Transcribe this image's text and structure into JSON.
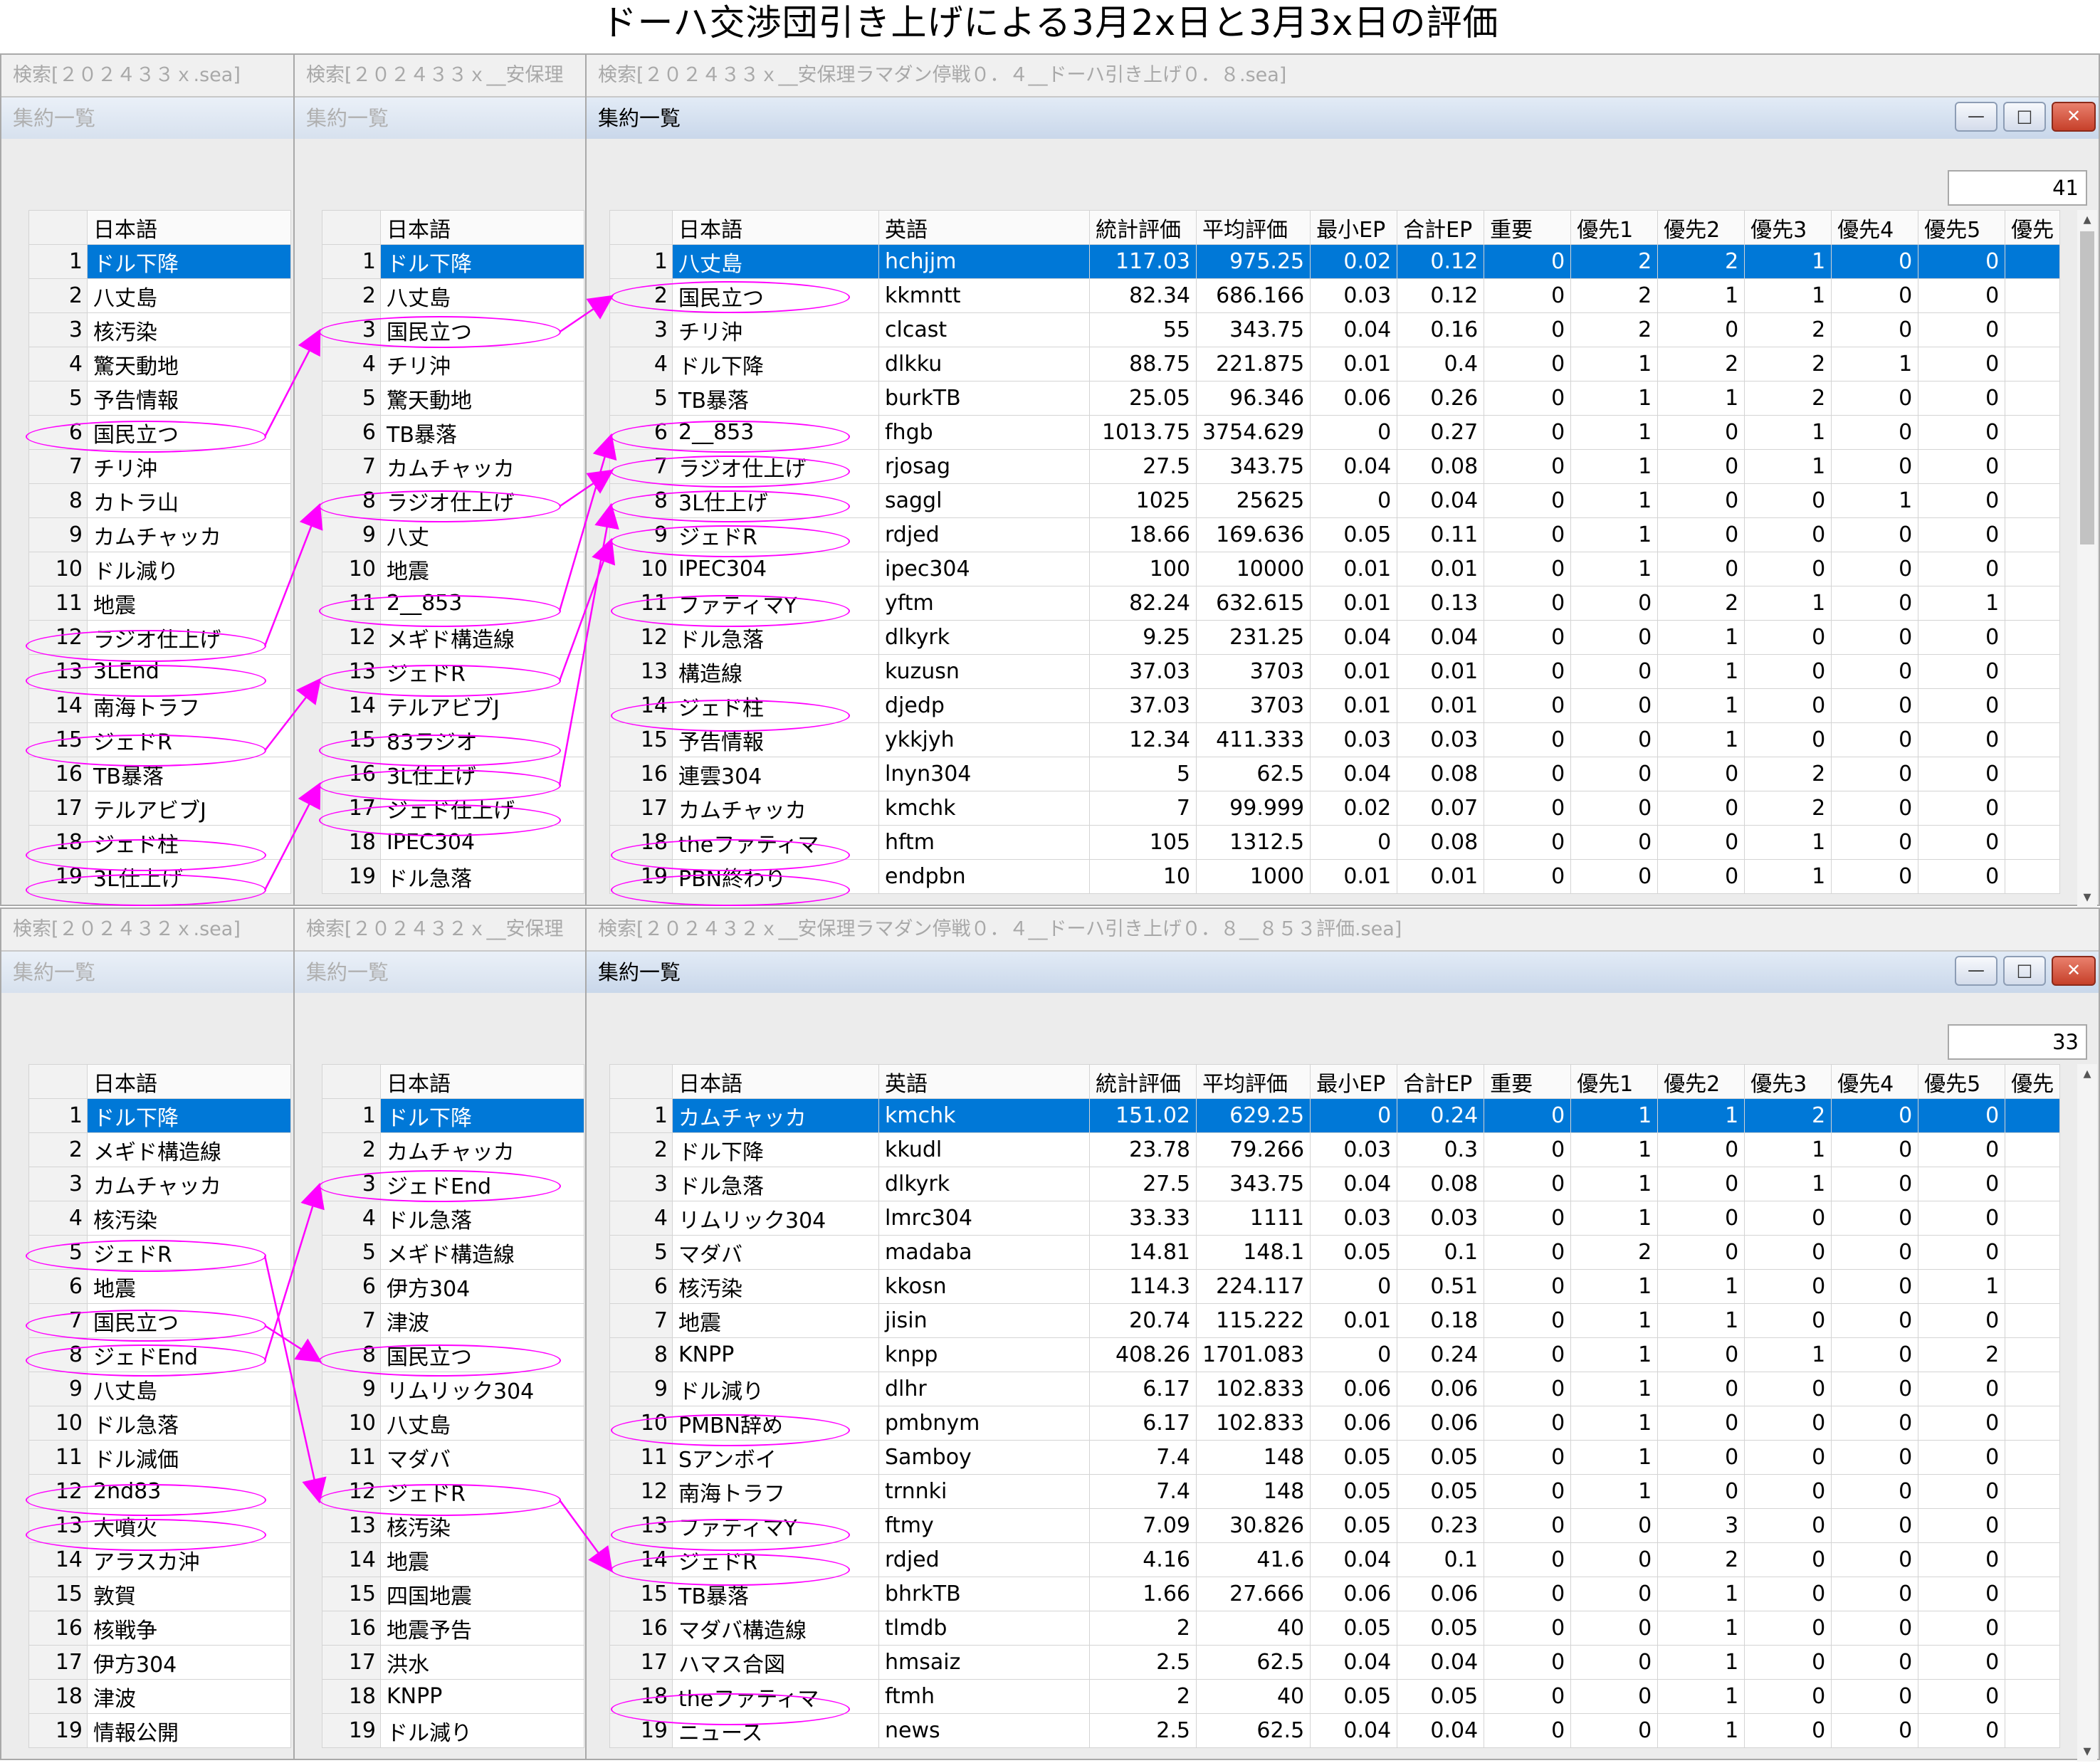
{
  "title": "ドーハ交渉団引き上げによる3月2x日と3月3x日の評価",
  "accent_color": "#0078d7",
  "annotation_color": "#ff00ff",
  "top": {
    "win1_title": "検索[２０２４３３ｘ.sea]",
    "win2_title": "検索[２０２４３３ｘ__安保理",
    "win3_title": "検索[２０２４３３ｘ__安保理ラマダン停戦０．４__ドーハ引き上げ０．８.sea]",
    "subtitle": "集約一覧",
    "count": "41",
    "col_jp": "日本語",
    "list1": [
      "ドル下降",
      "八丈島",
      "核汚染",
      "驚天動地",
      "予告情報",
      "国民立つ",
      "チリ沖",
      "カトラ山",
      "カムチャッカ",
      "ドル減り",
      "地震",
      "ラジオ仕上げ",
      "3LEnd",
      "南海トラフ",
      "ジェドR",
      "TB暴落",
      "テルアビブJ",
      "ジェド柱",
      "3L仕上げ"
    ],
    "list2": [
      "ドル下降",
      "八丈島",
      "国民立つ",
      "チリ沖",
      "驚天動地",
      "TB暴落",
      "カムチャッカ",
      "ラジオ仕上げ",
      "八丈",
      "地震",
      "2__853",
      "メギド構造線",
      "ジェドR",
      "テルアビブJ",
      "83ラジオ",
      "3L仕上げ",
      "ジェド仕上げ",
      "IPEC304",
      "ドル急落"
    ],
    "headers": [
      "日本語",
      "英語",
      "統計評価",
      "平均評価",
      "最小EP",
      "合計EP",
      "重要",
      "優先1",
      "優先2",
      "優先3",
      "優先4",
      "優先5",
      "優先"
    ],
    "rows": [
      [
        "八丈島",
        "hchjjm",
        "117.03",
        "975.25",
        "0.02",
        "0.12",
        "0",
        "2",
        "2",
        "1",
        "0",
        "0"
      ],
      [
        "国民立つ",
        "kkmntt",
        "82.34",
        "686.166",
        "0.03",
        "0.12",
        "0",
        "2",
        "1",
        "1",
        "0",
        "0"
      ],
      [
        "チリ沖",
        "clcast",
        "55",
        "343.75",
        "0.04",
        "0.16",
        "0",
        "2",
        "0",
        "2",
        "0",
        "0"
      ],
      [
        "ドル下降",
        "dlkku",
        "88.75",
        "221.875",
        "0.01",
        "0.4",
        "0",
        "1",
        "2",
        "2",
        "1",
        "0"
      ],
      [
        "TB暴落",
        "burkTB",
        "25.05",
        "96.346",
        "0.06",
        "0.26",
        "0",
        "1",
        "1",
        "2",
        "0",
        "0"
      ],
      [
        "2__853",
        "fhgb",
        "1013.75",
        "3754.629",
        "0",
        "0.27",
        "0",
        "1",
        "0",
        "1",
        "0",
        "0"
      ],
      [
        "ラジオ仕上げ",
        "rjosag",
        "27.5",
        "343.75",
        "0.04",
        "0.08",
        "0",
        "1",
        "0",
        "1",
        "0",
        "0"
      ],
      [
        "3L仕上げ",
        "saggl",
        "1025",
        "25625",
        "0",
        "0.04",
        "0",
        "1",
        "0",
        "0",
        "1",
        "0"
      ],
      [
        "ジェドR",
        "rdjed",
        "18.66",
        "169.636",
        "0.05",
        "0.11",
        "0",
        "1",
        "0",
        "0",
        "0",
        "0"
      ],
      [
        "IPEC304",
        "ipec304",
        "100",
        "10000",
        "0.01",
        "0.01",
        "0",
        "1",
        "0",
        "0",
        "0",
        "0"
      ],
      [
        "ファティマY",
        "yftm",
        "82.24",
        "632.615",
        "0.01",
        "0.13",
        "0",
        "0",
        "2",
        "1",
        "0",
        "1"
      ],
      [
        "ドル急落",
        "dlkyrk",
        "9.25",
        "231.25",
        "0.04",
        "0.04",
        "0",
        "0",
        "1",
        "0",
        "0",
        "0"
      ],
      [
        "構造線",
        "kuzusn",
        "37.03",
        "3703",
        "0.01",
        "0.01",
        "0",
        "0",
        "1",
        "0",
        "0",
        "0"
      ],
      [
        "ジェド柱",
        "djedp",
        "37.03",
        "3703",
        "0.01",
        "0.01",
        "0",
        "0",
        "1",
        "0",
        "0",
        "0"
      ],
      [
        "予告情報",
        "ykkjyh",
        "12.34",
        "411.333",
        "0.03",
        "0.03",
        "0",
        "0",
        "1",
        "0",
        "0",
        "0"
      ],
      [
        "連雲304",
        "lnyn304",
        "5",
        "62.5",
        "0.04",
        "0.08",
        "0",
        "0",
        "0",
        "2",
        "0",
        "0"
      ],
      [
        "カムチャッカ",
        "kmchk",
        "7",
        "99.999",
        "0.02",
        "0.07",
        "0",
        "0",
        "0",
        "2",
        "0",
        "0"
      ],
      [
        "theファティマ",
        "hftm",
        "105",
        "1312.5",
        "0",
        "0.08",
        "0",
        "0",
        "0",
        "1",
        "0",
        "0"
      ],
      [
        "PBN終わり",
        "endpbn",
        "10",
        "1000",
        "0.01",
        "0.01",
        "0",
        "0",
        "0",
        "1",
        "0",
        "0"
      ]
    ]
  },
  "bottom": {
    "win1_title": "検索[２０２４３２ｘ.sea]",
    "win2_title": "検索[２０２４３２ｘ__安保理",
    "win3_title": "検索[２０２４３２ｘ__安保理ラマダン停戦０．４__ドーハ引き上げ０．８__８５３評価.sea]",
    "subtitle": "集約一覧",
    "count": "33",
    "col_jp": "日本語",
    "list1": [
      "ドル下降",
      "メギド構造線",
      "カムチャッカ",
      "核汚染",
      "ジェドR",
      "地震",
      "国民立つ",
      "ジェドEnd",
      "八丈島",
      "ドル急落",
      "ドル減価",
      "2nd83",
      "大噴火",
      "アラスカ沖",
      "敦賀",
      "核戦争",
      "伊方304",
      "津波",
      "情報公開"
    ],
    "list2": [
      "ドル下降",
      "カムチャッカ",
      "ジェドEnd",
      "ドル急落",
      "メギド構造線",
      "伊方304",
      "津波",
      "国民立つ",
      "リムリック304",
      "八丈島",
      "マダバ",
      "ジェドR",
      "核汚染",
      "地震",
      "四国地震",
      "地震予告",
      "洪水",
      "KNPP",
      "ドル減り"
    ],
    "headers": [
      "日本語",
      "英語",
      "統計評価",
      "平均評価",
      "最小EP",
      "合計EP",
      "重要",
      "優先1",
      "優先2",
      "優先3",
      "優先4",
      "優先5",
      "優先"
    ],
    "rows": [
      [
        "カムチャッカ",
        "kmchk",
        "151.02",
        "629.25",
        "0",
        "0.24",
        "0",
        "1",
        "1",
        "2",
        "0",
        "0"
      ],
      [
        "ドル下降",
        "kkudl",
        "23.78",
        "79.266",
        "0.03",
        "0.3",
        "0",
        "1",
        "0",
        "1",
        "0",
        "0"
      ],
      [
        "ドル急落",
        "dlkyrk",
        "27.5",
        "343.75",
        "0.04",
        "0.08",
        "0",
        "1",
        "0",
        "1",
        "0",
        "0"
      ],
      [
        "リムリック304",
        "lmrc304",
        "33.33",
        "1111",
        "0.03",
        "0.03",
        "0",
        "1",
        "0",
        "0",
        "0",
        "0"
      ],
      [
        "マダバ",
        "madaba",
        "14.81",
        "148.1",
        "0.05",
        "0.1",
        "0",
        "2",
        "0",
        "0",
        "0",
        "0"
      ],
      [
        "核汚染",
        "kkosn",
        "114.3",
        "224.117",
        "0",
        "0.51",
        "0",
        "1",
        "1",
        "0",
        "0",
        "1"
      ],
      [
        "地震",
        "jisin",
        "20.74",
        "115.222",
        "0.01",
        "0.18",
        "0",
        "1",
        "1",
        "0",
        "0",
        "0"
      ],
      [
        "KNPP",
        "knpp",
        "408.26",
        "1701.083",
        "0",
        "0.24",
        "0",
        "1",
        "0",
        "1",
        "0",
        "2"
      ],
      [
        "ドル減り",
        "dlhr",
        "6.17",
        "102.833",
        "0.06",
        "0.06",
        "0",
        "1",
        "0",
        "0",
        "0",
        "0"
      ],
      [
        "PMBN辞め",
        "pmbnym",
        "6.17",
        "102.833",
        "0.06",
        "0.06",
        "0",
        "1",
        "0",
        "0",
        "0",
        "0"
      ],
      [
        "Sアンボイ",
        "Samboy",
        "7.4",
        "148",
        "0.05",
        "0.05",
        "0",
        "1",
        "0",
        "0",
        "0",
        "0"
      ],
      [
        "南海トラフ",
        "trnnki",
        "7.4",
        "148",
        "0.05",
        "0.05",
        "0",
        "1",
        "0",
        "0",
        "0",
        "0"
      ],
      [
        "ファティマY",
        "ftmy",
        "7.09",
        "30.826",
        "0.05",
        "0.23",
        "0",
        "0",
        "3",
        "0",
        "0",
        "0"
      ],
      [
        "ジェドR",
        "rdjed",
        "4.16",
        "41.6",
        "0.04",
        "0.1",
        "0",
        "0",
        "2",
        "0",
        "0",
        "0"
      ],
      [
        "TB暴落",
        "bhrkTB",
        "1.66",
        "27.666",
        "0.06",
        "0.06",
        "0",
        "0",
        "1",
        "0",
        "0",
        "0"
      ],
      [
        "マダバ構造線",
        "tlmdb",
        "2",
        "40",
        "0.05",
        "0.05",
        "0",
        "0",
        "1",
        "0",
        "0",
        "0"
      ],
      [
        "ハマス合図",
        "hmsaiz",
        "2.5",
        "62.5",
        "0.04",
        "0.04",
        "0",
        "0",
        "1",
        "0",
        "0",
        "0"
      ],
      [
        "theファティマ",
        "ftmh",
        "2",
        "40",
        "0.05",
        "0.05",
        "0",
        "0",
        "1",
        "0",
        "0",
        "0"
      ],
      [
        "ニュース",
        "news",
        "2.5",
        "62.5",
        "0.04",
        "0.04",
        "0",
        "0",
        "1",
        "0",
        "0",
        "0"
      ]
    ]
  }
}
